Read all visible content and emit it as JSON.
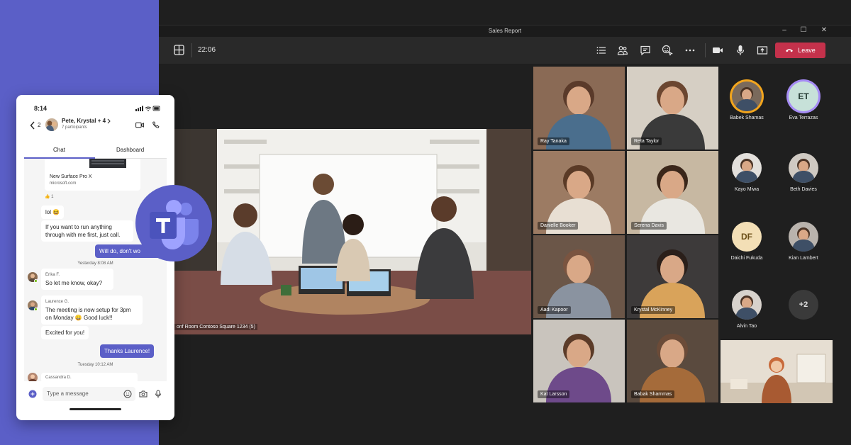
{
  "window": {
    "title": "Sales Report"
  },
  "toolbar": {
    "time": "22:06",
    "leave_label": "Leave"
  },
  "room": {
    "label": "onf Room Contoso Square 1234 (5)"
  },
  "tiles": [
    {
      "name": "Ray Tanaka"
    },
    {
      "name": "Reta Taylor"
    },
    {
      "name": "Danielle Booker"
    },
    {
      "name": "Serena Davis"
    },
    {
      "name": "Aadi Kapoor"
    },
    {
      "name": "Krystal McKinney"
    },
    {
      "name": "Kat Larsson"
    },
    {
      "name": "Babak Shammas"
    }
  ],
  "roster": [
    {
      "name": "Babek Shamas",
      "initials": ""
    },
    {
      "name": "Eva Terrazas",
      "initials": "ET"
    },
    {
      "name": "Kayo Miwa",
      "initials": ""
    },
    {
      "name": "Beth Davies",
      "initials": ""
    },
    {
      "name": "Daichi Fukuda",
      "initials": "DF"
    },
    {
      "name": "Kian Lambert",
      "initials": ""
    },
    {
      "name": "Alvin Tao",
      "initials": ""
    },
    {
      "name": "",
      "initials": "+2"
    }
  ],
  "phone": {
    "time": "8:14",
    "back_count": "2",
    "chat_title": "Pete, Krystal + 4",
    "chat_subtitle": "7 participants",
    "tabs": [
      "Chat",
      "Dashboard"
    ],
    "link_card": {
      "title": "New Surface Pro X",
      "url": "microsoft.com",
      "reaction": "1"
    },
    "messages": [
      {
        "text": "lol 😆"
      },
      {
        "text": "If you want to run anything through with me first, just call."
      },
      {
        "text": "Will do, don't wo"
      },
      {
        "time": "Yesterday 8:08 AM"
      },
      {
        "sender": "Erika F.",
        "text": "So let me know, okay?"
      },
      {
        "sender": "Laurence G.",
        "text": "The meeting is now setup for 3pm on Monday 😀 Good luck!!"
      },
      {
        "text": "Excited for you!"
      },
      {
        "text": "Thanks Laurence!"
      },
      {
        "time": "Tuesday 10:12 AM"
      },
      {
        "sender": "Cassandra D."
      }
    ],
    "input_placeholder": "Type a message"
  },
  "colors": {
    "brand": "#5b5fc7",
    "leave": "#c4314b",
    "background": "#1f1f1f",
    "toolbar": "#292929"
  }
}
